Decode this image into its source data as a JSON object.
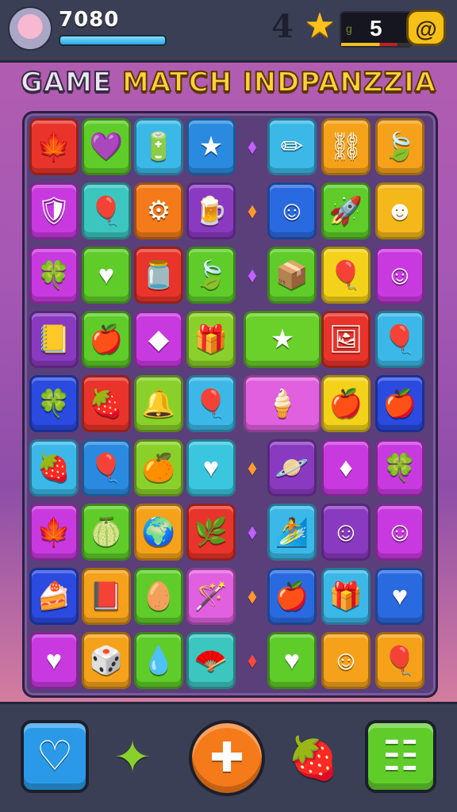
{
  "hud": {
    "score": "7080",
    "xp_fraction": 1.0,
    "level": "4",
    "counter_tag": "g",
    "counter_value": "5",
    "coin_label": "@"
  },
  "title": {
    "word1": "GAME",
    "word2": "MATCH INDPANZZIA"
  },
  "board": {
    "rows": [
      [
        {
          "color": "#e8342a",
          "icon": "leaf-icon",
          "glyph": "🍁"
        },
        {
          "color": "#5fcc2a",
          "icon": "heart-balloon-icon",
          "glyph": "💜"
        },
        {
          "color": "#3bb8e8",
          "icon": "battery-icon",
          "glyph": "🔋"
        },
        {
          "color": "#2a8ae0",
          "icon": "star-icon",
          "glyph": "★"
        },
        {
          "gem": "purple-gem-icon",
          "glyph": "⬧"
        },
        {
          "color": "#3bb8e8",
          "icon": "pencil-icon",
          "glyph": "✏"
        },
        {
          "color": "#f5a21a",
          "icon": "pillar-icon",
          "glyph": "⛓"
        },
        {
          "color": "#f5a21a",
          "icon": "green-leaf-icon",
          "glyph": "🍃"
        }
      ],
      [
        {
          "color": "#c83ae0",
          "icon": "shield-icon",
          "glyph": "🛡"
        },
        {
          "color": "#3bc6c0",
          "icon": "balloon-icon",
          "glyph": "🎈"
        },
        {
          "color": "#f57a1a",
          "icon": "gadget-icon",
          "glyph": "⚙"
        },
        {
          "color": "#8a3ac0",
          "icon": "beer-icon",
          "glyph": "🍺"
        },
        {
          "gem": "orange-gem-icon",
          "glyph": "⬧"
        },
        {
          "color": "#2a6ae0",
          "icon": "boy-face-icon",
          "glyph": "☺"
        },
        {
          "color": "#5fcc2a",
          "icon": "rocket-icon",
          "glyph": "🚀"
        },
        {
          "color": "#f5b81a",
          "icon": "green-face-icon",
          "glyph": "☻"
        }
      ],
      [
        {
          "color": "#c83ae0",
          "icon": "clover-icon",
          "glyph": "🍀"
        },
        {
          "color": "#5fcc2a",
          "icon": "heart-icon",
          "glyph": "♥"
        },
        {
          "color": "#e8342a",
          "icon": "jar-icon",
          "glyph": "🫙"
        },
        {
          "color": "#5fcc2a",
          "icon": "leaf-blob-icon",
          "glyph": "🍃"
        },
        {
          "gem": "purple-gem-icon",
          "glyph": "⬧"
        },
        {
          "color": "#5fcc2a",
          "icon": "box-icon",
          "glyph": "📦"
        },
        {
          "color": "#f5d21a",
          "icon": "balloon-icon",
          "glyph": "🎈"
        },
        {
          "color": "#c83ae0",
          "icon": "face-icon",
          "glyph": "☺"
        }
      ],
      [
        {
          "color": "#8a3ac0",
          "icon": "book-icon",
          "glyph": "📒"
        },
        {
          "color": "#5fcc2a",
          "icon": "apple-icon",
          "glyph": "🍎"
        },
        {
          "color": "#c83ae0",
          "icon": "cube-icon",
          "glyph": "◆"
        },
        {
          "color": "#8ad02a",
          "icon": "gift-icon",
          "glyph": "🎁"
        },
        {
          "color": "#6ad02a",
          "icon": "wide-star-icon",
          "glyph": "★",
          "wide": true
        },
        {
          "color": "#e8342a",
          "icon": "photo-icon",
          "glyph": "🖼"
        },
        {
          "color": "#3bb8e8",
          "icon": "balloon-icon",
          "glyph": "🎈"
        }
      ],
      [
        {
          "color": "#2a4ae0",
          "icon": "clover-icon",
          "glyph": "🍀"
        },
        {
          "color": "#e8342a",
          "icon": "strawberry-icon",
          "glyph": "🍓"
        },
        {
          "color": "#8ad02a",
          "icon": "bell-icon",
          "glyph": "🔔"
        },
        {
          "color": "#3bb8e8",
          "icon": "pink-balloon-icon",
          "glyph": "🎈"
        },
        {
          "color": "#e060e0",
          "icon": "wide-cone-icon",
          "glyph": "🍦",
          "wide": true
        },
        {
          "color": "#f5d21a",
          "icon": "apple-icon",
          "glyph": "🍎"
        },
        {
          "color": "#2a4ae0",
          "icon": "apple-icon",
          "glyph": "🍎"
        }
      ],
      [
        {
          "color": "#3bb8e8",
          "icon": "strawberry-icon",
          "glyph": "🍓"
        },
        {
          "color": "#2a8ae0",
          "icon": "balloon-icon",
          "glyph": "🎈"
        },
        {
          "color": "#8ad02a",
          "icon": "orange-icon",
          "glyph": "🍊"
        },
        {
          "color": "#3bc6e0",
          "icon": "heart-icon",
          "glyph": "♥"
        },
        {
          "gem": "orange-gem-icon",
          "glyph": "⬧"
        },
        {
          "color": "#8a3ac0",
          "icon": "planet-icon",
          "glyph": "🪐"
        },
        {
          "color": "#c83ae0",
          "icon": "gem-icon",
          "glyph": "♦"
        },
        {
          "color": "#c83ae0",
          "icon": "clover-icon",
          "glyph": "🍀"
        }
      ],
      [
        {
          "color": "#c83ae0",
          "icon": "leaf-icon",
          "glyph": "🍁"
        },
        {
          "color": "#5fcc2a",
          "icon": "melon-icon",
          "glyph": "🍈"
        },
        {
          "color": "#f5a21a",
          "icon": "globe-heart-icon",
          "glyph": "🌍"
        },
        {
          "color": "#e8342a",
          "icon": "plant-icon",
          "glyph": "🌿"
        },
        {
          "gem": "purple-gem-icon",
          "glyph": "⬧"
        },
        {
          "color": "#3bb8e8",
          "icon": "surfboard-icon",
          "glyph": "🏄"
        },
        {
          "color": "#8a3ac0",
          "icon": "girl-face-icon",
          "glyph": "☺"
        },
        {
          "color": "#c83ae0",
          "icon": "boy-face-icon",
          "glyph": "☺"
        }
      ],
      [
        {
          "color": "#2a4ae0",
          "icon": "cake-icon",
          "glyph": "🍰"
        },
        {
          "color": "#f5a21a",
          "icon": "book-icon",
          "glyph": "📕"
        },
        {
          "color": "#5fcc2a",
          "icon": "egg-icon",
          "glyph": "🥚"
        },
        {
          "color": "#e060e0",
          "icon": "wand-icon",
          "glyph": "🪄"
        },
        {
          "gem": "orange-gem-icon",
          "glyph": "⬧"
        },
        {
          "color": "#2a6ae0",
          "icon": "apple-icon",
          "glyph": "🍎"
        },
        {
          "color": "#3bb8e8",
          "icon": "gift-box-icon",
          "glyph": "🎁"
        },
        {
          "color": "#2a6ae0",
          "icon": "heart-icon",
          "glyph": "♥"
        }
      ],
      [
        {
          "color": "#c83ae0",
          "icon": "heart-icon",
          "glyph": "♥"
        },
        {
          "color": "#f5a21a",
          "icon": "dice-icon",
          "glyph": "🎲"
        },
        {
          "color": "#5fcc2a",
          "icon": "drop-icon",
          "glyph": "💧"
        },
        {
          "color": "#3bc6c0",
          "icon": "fan-icon",
          "glyph": "🪭"
        },
        {
          "gem": "red-gem-icon",
          "glyph": "⬧"
        },
        {
          "color": "#5fcc2a",
          "icon": "heart-icon",
          "glyph": "♥"
        },
        {
          "color": "#f5a21a",
          "icon": "boy-face-icon",
          "glyph": "☺"
        },
        {
          "color": "#f5a21a",
          "icon": "balloon-icon",
          "glyph": "🎈"
        }
      ]
    ]
  },
  "bottom": {
    "buttons": [
      {
        "name": "heart-power-button",
        "icon": "heart-icon",
        "glyph": "♡",
        "color": "#2a9ae8"
      },
      {
        "name": "sparkle-button",
        "icon": "sparkle-icon",
        "glyph": "✦",
        "color": "transparent"
      },
      {
        "name": "shape-power-button",
        "icon": "shape-icon",
        "glyph": "✚",
        "color": "#f57a1a"
      },
      {
        "name": "strawberry-power-button",
        "icon": "strawberry-icon",
        "glyph": "🍓",
        "color": "transparent"
      },
      {
        "name": "menu-button",
        "icon": "menu-grid-icon",
        "glyph": "☷",
        "color": "#5fcc2a"
      }
    ]
  },
  "colors": {
    "topbar": "#3a3f55",
    "board": "#5a3f7a",
    "title_yellow": "#ffd23a"
  }
}
